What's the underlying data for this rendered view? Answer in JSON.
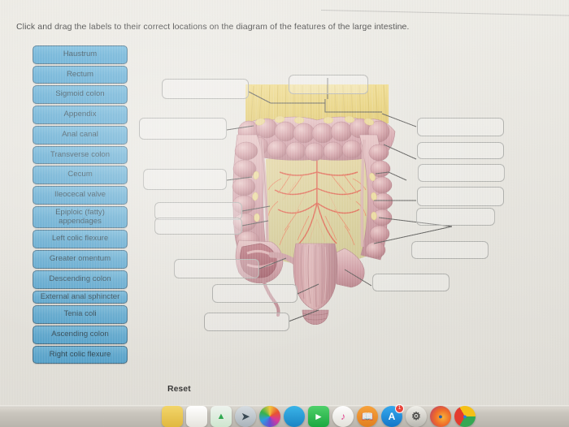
{
  "prompt": "Click and drag the labels to their correct locations on the diagram of the features of the large intestine.",
  "reset_label": "Reset",
  "colors": {
    "chip_fill": "#4da5d4",
    "chip_border": "#2d5f7d",
    "chip_text": "#14303f",
    "page_bg": "#eceae3",
    "box_border": "#a9aaa6",
    "leader_line": "#3a3a38"
  },
  "labels": [
    {
      "id": "haustrum",
      "text": "Haustrum"
    },
    {
      "id": "rectum",
      "text": "Rectum"
    },
    {
      "id": "sigmoid-colon",
      "text": "Sigmoid colon"
    },
    {
      "id": "appendix",
      "text": "Appendix"
    },
    {
      "id": "anal-canal",
      "text": "Anal canal"
    },
    {
      "id": "transverse-colon",
      "text": "Transverse colon"
    },
    {
      "id": "cecum",
      "text": "Cecum"
    },
    {
      "id": "ileocecal-valve",
      "text": "Ileocecal valve"
    },
    {
      "id": "epiploic-appendages",
      "text": "Epiploic (fatty) appendages"
    },
    {
      "id": "left-colic-flexure",
      "text": "Left colic flexure"
    },
    {
      "id": "greater-omentum",
      "text": "Greater omentum"
    },
    {
      "id": "descending-colon",
      "text": "Descending colon"
    },
    {
      "id": "external-anal-sphincter",
      "text": "External anal sphincter"
    },
    {
      "id": "tenia-coli",
      "text": "Tenia coli"
    },
    {
      "id": "ascending-colon",
      "text": "Ascending colon"
    },
    {
      "id": "right-colic-flexure",
      "text": "Right colic flexure"
    }
  ],
  "drop_targets": [
    {
      "id": "target-1",
      "value": "",
      "side": "left"
    },
    {
      "id": "target-2",
      "value": "",
      "side": "left"
    },
    {
      "id": "target-3",
      "value": "",
      "side": "left"
    },
    {
      "id": "target-4",
      "value": "",
      "side": "left"
    },
    {
      "id": "target-5",
      "value": "",
      "side": "left"
    },
    {
      "id": "target-6",
      "value": "",
      "side": "left"
    },
    {
      "id": "target-7",
      "value": "",
      "side": "left"
    },
    {
      "id": "target-8",
      "value": "",
      "side": "left"
    },
    {
      "id": "target-9",
      "value": "",
      "side": "top"
    },
    {
      "id": "target-10",
      "value": "",
      "side": "right"
    },
    {
      "id": "target-11",
      "value": "",
      "side": "right"
    },
    {
      "id": "target-12",
      "value": "",
      "side": "right"
    },
    {
      "id": "target-13",
      "value": "",
      "side": "right"
    },
    {
      "id": "target-14",
      "value": "",
      "side": "right"
    },
    {
      "id": "target-15",
      "value": "",
      "side": "right"
    },
    {
      "id": "target-16",
      "value": "",
      "side": "right"
    }
  ],
  "diagram": {
    "title": "Large intestine",
    "alt": "Anatomical illustration of the large intestine showing haustra, tenia coli, epiploic appendages, mesenteric vessels, cecum, appendix, rectum and anal canal"
  },
  "dock": {
    "items": [
      {
        "id": "finder",
        "name": "finder-icon",
        "badge": ""
      },
      {
        "id": "notes",
        "name": "notes-icon",
        "badge": ""
      },
      {
        "id": "preview",
        "name": "preview-icon",
        "badge": ""
      },
      {
        "id": "photos",
        "name": "photos-icon",
        "badge": ""
      },
      {
        "id": "safari",
        "name": "safari-icon",
        "badge": ""
      },
      {
        "id": "messages",
        "name": "messages-icon",
        "badge": ""
      },
      {
        "id": "facetime",
        "name": "facetime-icon",
        "badge": ""
      },
      {
        "id": "itunes",
        "name": "itunes-icon",
        "badge": ""
      },
      {
        "id": "ibooks",
        "name": "ibooks-icon",
        "badge": ""
      },
      {
        "id": "appstore",
        "name": "app-store-icon",
        "badge": "1"
      },
      {
        "id": "settings",
        "name": "gear-icon",
        "badge": ""
      },
      {
        "id": "firefox",
        "name": "firefox-icon",
        "badge": ""
      },
      {
        "id": "chrome",
        "name": "chrome-icon",
        "badge": ""
      }
    ]
  }
}
